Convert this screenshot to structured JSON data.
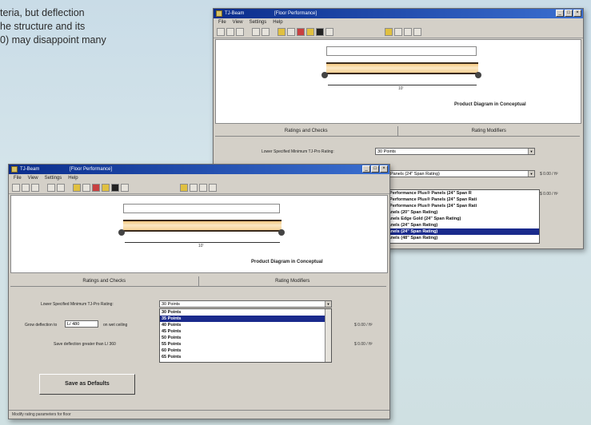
{
  "caption": {
    "line1": "teria, but deflection",
    "line2": "he structure and its",
    "line3": "0) may disappoint many"
  },
  "back_window": {
    "title": "TJ-Beam",
    "document": "[Floor Performance]",
    "menus": [
      "File",
      "View",
      "Settings",
      "Help"
    ],
    "diagram_label": "Product Diagram in Conceptual",
    "dimension_label": "10'",
    "tabs": [
      "Ratings and Checks",
      "Rating Modifiers"
    ],
    "row1_label": "Lower Specified Minimum TJ-Pro Rating:",
    "row1_value": "30 Points",
    "row2_value": "Panels (24\" Span Rating)",
    "row2_result": "$ 0.00 / ft²",
    "row3_result": "$ 0.00 / ft²",
    "dropdown_items": [
      "+-Performance Plus® Panels (24\" Span R",
      "+-Performance Plus® Panels (24\" Span Rati",
      "+-Performance Plus® Panels (24\" Span Rati",
      "Panels (20\" Span Rating)",
      "Panels Edge Gold (24\" Span Rating)",
      "Panels (24\" Span Rating)",
      "Panels (24\" Span Rating)",
      "Panels (48\" Span Rating)"
    ],
    "dropdown_selected": 6
  },
  "front_window": {
    "title": "TJ-Beam",
    "document": "[Floor Performance]",
    "menus": [
      "File",
      "View",
      "Settings",
      "Help"
    ],
    "diagram_label": "Product Diagram in Conceptual",
    "dimension_label": "10'",
    "tabs": [
      "Ratings and Checks",
      "Rating Modifiers"
    ],
    "row1_label": "Lower Specified Minimum TJ-Pro Rating:",
    "row1_value": "30 Points",
    "row2_label": "Grow deflection to",
    "row2_input": "L/ 480",
    "row2_suffix": "on wet ceiling",
    "row3_label": "Save deflection greater than L/ 360",
    "list_items": [
      "30 Points",
      "35 Points",
      "40 Points",
      "45 Points",
      "50 Points",
      "55 Points",
      "60 Points",
      "65 Points"
    ],
    "list_selected": 1,
    "result1": "$ 0.00 / ft²",
    "result2": "$ 0.00 / ft²",
    "save_button": "Save as Defaults",
    "status_text": "Modify rating parameters for floor"
  }
}
